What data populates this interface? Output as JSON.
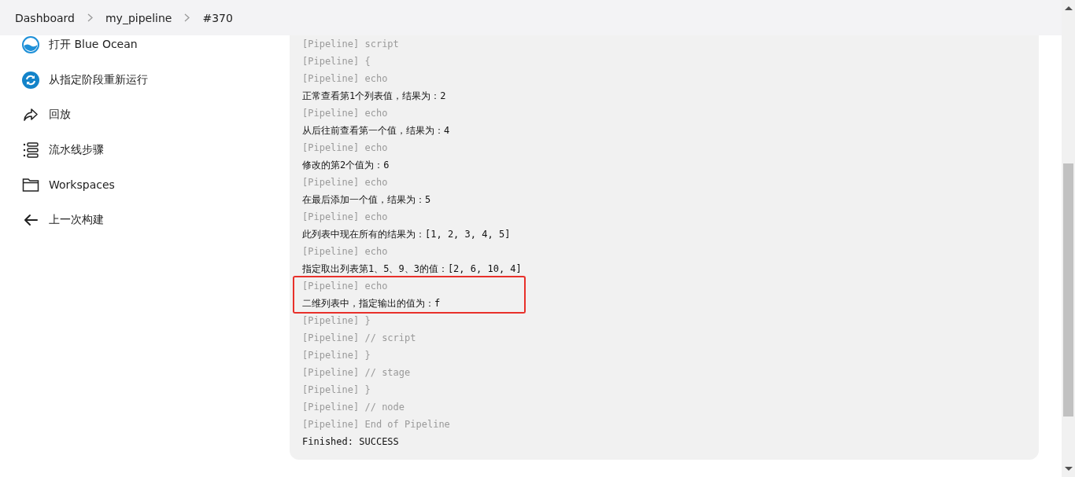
{
  "breadcrumb": [
    "Dashboard",
    "my_pipeline",
    "#370"
  ],
  "sidebar": {
    "items": [
      {
        "kind": "blue-ocean",
        "label": "打开 Blue Ocean"
      },
      {
        "kind": "restart",
        "label": "从指定阶段重新运行"
      },
      {
        "kind": "replay",
        "label": "回放"
      },
      {
        "kind": "steps",
        "label": "流水线步骤"
      },
      {
        "kind": "folder",
        "label": "Workspaces"
      },
      {
        "kind": "back",
        "label": "上一次构建"
      }
    ]
  },
  "console": {
    "lines": [
      {
        "kind": "meta",
        "text": "[Pipeline] script",
        "highlighted": false
      },
      {
        "kind": "meta",
        "text": "[Pipeline] {",
        "highlighted": false
      },
      {
        "kind": "meta",
        "text": "[Pipeline] echo",
        "highlighted": false
      },
      {
        "kind": "output",
        "text": "正常查看第1个列表值，结果为：2",
        "highlighted": false
      },
      {
        "kind": "meta",
        "text": "[Pipeline] echo",
        "highlighted": false
      },
      {
        "kind": "output",
        "text": "从后往前查看第一个值，结果为：4",
        "highlighted": false
      },
      {
        "kind": "meta",
        "text": "[Pipeline] echo",
        "highlighted": false
      },
      {
        "kind": "output",
        "text": "修改的第2个值为：6",
        "highlighted": false
      },
      {
        "kind": "meta",
        "text": "[Pipeline] echo",
        "highlighted": false
      },
      {
        "kind": "output",
        "text": "在最后添加一个值，结果为：5",
        "highlighted": false
      },
      {
        "kind": "meta",
        "text": "[Pipeline] echo",
        "highlighted": false
      },
      {
        "kind": "output",
        "text": "此列表中现在所有的结果为：[1, 2, 3, 4, 5]",
        "highlighted": false
      },
      {
        "kind": "meta",
        "text": "[Pipeline] echo",
        "highlighted": false
      },
      {
        "kind": "output",
        "text": "指定取出列表第1、5、9、3的值：[2, 6, 10, 4]",
        "highlighted": false
      },
      {
        "kind": "meta",
        "text": "[Pipeline] echo",
        "highlighted": true
      },
      {
        "kind": "output",
        "text": "二维列表中，指定输出的值为：f",
        "highlighted": true
      },
      {
        "kind": "meta",
        "text": "[Pipeline] }",
        "highlighted": false
      },
      {
        "kind": "meta",
        "text": "[Pipeline] // script",
        "highlighted": false
      },
      {
        "kind": "meta",
        "text": "[Pipeline] }",
        "highlighted": false
      },
      {
        "kind": "meta",
        "text": "[Pipeline] // stage",
        "highlighted": false
      },
      {
        "kind": "meta",
        "text": "[Pipeline] }",
        "highlighted": false
      },
      {
        "kind": "meta",
        "text": "[Pipeline] // node",
        "highlighted": false
      },
      {
        "kind": "meta",
        "text": "[Pipeline] End of Pipeline",
        "highlighted": false
      },
      {
        "kind": "output",
        "text": "Finished: SUCCESS",
        "highlighted": false
      }
    ]
  }
}
